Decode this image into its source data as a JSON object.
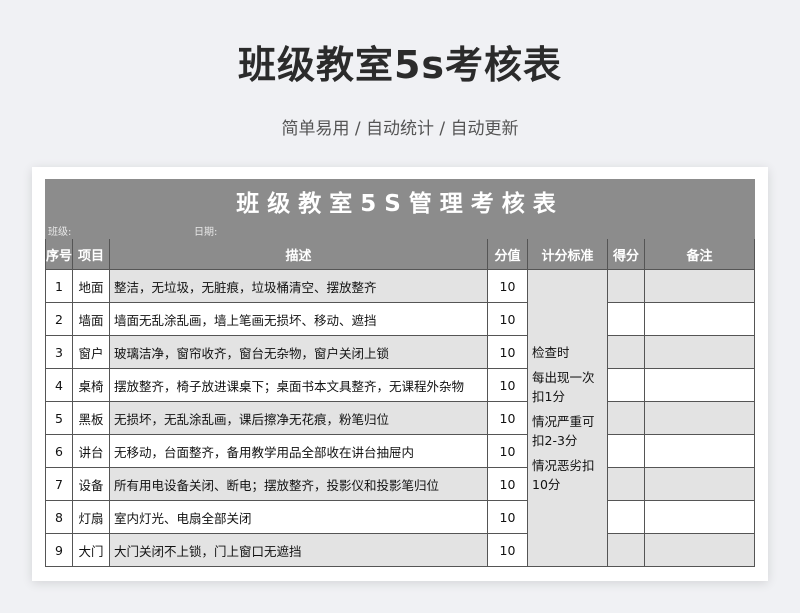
{
  "header": {
    "title": "班级教室5s考核表",
    "subtitle": "简单易用 / 自动统计 / 自动更新"
  },
  "sheet": {
    "banner": "班级教室5S管理考核表",
    "class_label": "班级:",
    "date_label": "日期:",
    "columns": [
      "序号",
      "项目",
      "描述",
      "分值",
      "计分标准",
      "得分",
      "备注"
    ],
    "rows": [
      {
        "no": "1",
        "item": "地面",
        "desc": "整洁，无垃圾，无脏痕，垃圾桶清空、摆放整齐",
        "score": "10"
      },
      {
        "no": "2",
        "item": "墙面",
        "desc": "墙面无乱涂乱画，墙上笔画无损坏、移动、遮挡",
        "score": "10"
      },
      {
        "no": "3",
        "item": "窗户",
        "desc": "玻璃洁净，窗帘收齐，窗台无杂物，窗户关闭上锁",
        "score": "10"
      },
      {
        "no": "4",
        "item": "桌椅",
        "desc": "摆放整齐，椅子放进课桌下；桌面书本文具整齐，无课程外杂物",
        "score": "10"
      },
      {
        "no": "5",
        "item": "黑板",
        "desc": "无损坏，无乱涂乱画，课后擦净无花痕，粉笔归位",
        "score": "10"
      },
      {
        "no": "6",
        "item": "讲台",
        "desc": "无移动，台面整齐，备用教学用品全部收在讲台抽屉内",
        "score": "10"
      },
      {
        "no": "7",
        "item": "设备",
        "desc": "所有用电设备关闭、断电；摆放整齐，投影仪和投影笔归位",
        "score": "10"
      },
      {
        "no": "8",
        "item": "灯扇",
        "desc": "室内灯光、电扇全部关闭",
        "score": "10"
      },
      {
        "no": "9",
        "item": "大门",
        "desc": "大门关闭不上锁，门上窗口无遮挡",
        "score": "10"
      }
    ],
    "criteria": [
      "检查时",
      "每出现一次扣1分",
      "情况严重可扣2-3分",
      "情况恶劣扣10分"
    ]
  }
}
